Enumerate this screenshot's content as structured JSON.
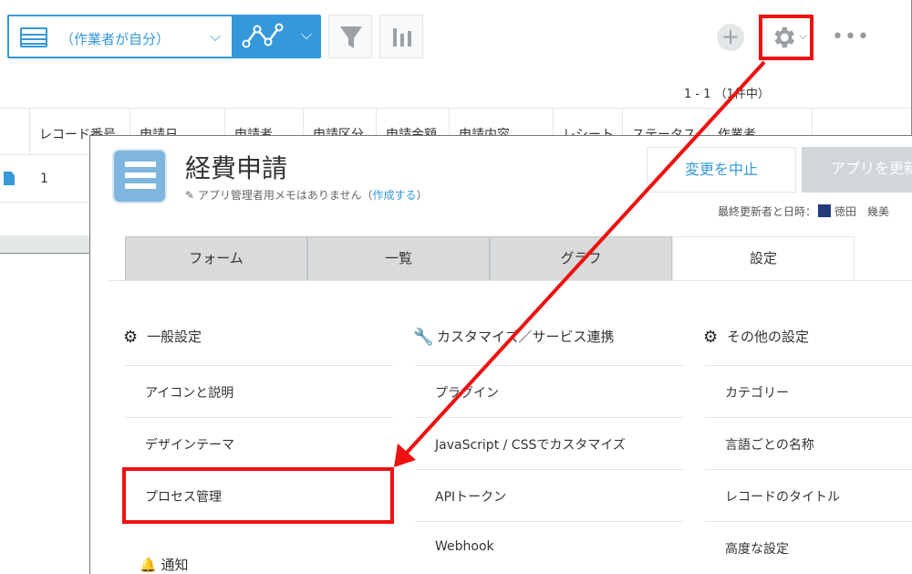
{
  "list_view": {
    "view_name": "（作業者が自分）",
    "pager": "1 - 1 （1件中）",
    "columns": [
      "レコード番号",
      "申請日",
      "申請者",
      "申請区分",
      "申請金額",
      "申請内容",
      "レシート",
      "ステータス",
      "作業者"
    ],
    "rows": [
      {
        "record_number": "1"
      }
    ],
    "icons": {
      "view": "table-grid-icon",
      "graph": "line-graph-icon",
      "filter": "funnel-icon",
      "aggregate": "bar-chart-icon",
      "add": "plus-icon",
      "settings": "gear-icon",
      "more": "ellipsis-icon"
    }
  },
  "app_settings": {
    "app_name": "経費申請",
    "memo_text": "アプリ管理者用メモはありません",
    "memo_link": "作成する",
    "cancel_button": "変更を中止",
    "update_button": "アプリを更新",
    "last_updated_label": "最終更新者と日時：",
    "last_updated_user": "徳田　幾美",
    "tabs": [
      {
        "label": "フォーム",
        "active": false
      },
      {
        "label": "一覧",
        "active": false
      },
      {
        "label": "グラフ",
        "active": false
      },
      {
        "label": "設定",
        "active": true
      }
    ],
    "sections": [
      {
        "title": "一般設定",
        "icon": "gear-icon",
        "items": [
          "アイコンと説明",
          "デザインテーマ",
          "プロセス管理"
        ]
      },
      {
        "title": "カスタマイズ／サービス連携",
        "icon": "wrench-icon",
        "items": [
          "プラグイン",
          "JavaScript / CSSでカスタマイズ",
          "APIトークン",
          "Webhook"
        ]
      },
      {
        "title": "その他の設定",
        "icon": "gears-icon",
        "items": [
          "カテゴリー",
          "言語ごとの名称",
          "レコードのタイトル",
          "高度な設定"
        ]
      }
    ],
    "notification_section": "通知"
  },
  "annotation": {
    "color": "#ee1111"
  }
}
